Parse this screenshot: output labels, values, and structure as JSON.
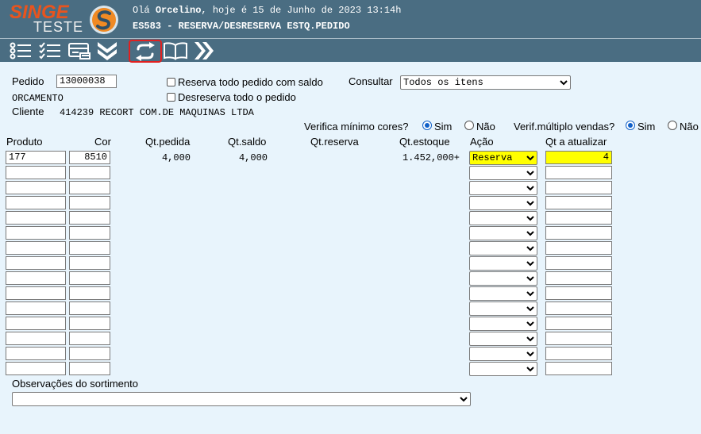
{
  "header": {
    "logo_top": "SINGE",
    "logo_bottom": "TESTE",
    "greeting_prefix": "Olá",
    "user_name": "Orcelino",
    "greeting_suffix": ", hoje é 15 de Junho de 2023 13:14h",
    "subtitle": "ES583 - RESERVA/DESRESERVA ESTQ.PEDIDO"
  },
  "toolbar": {
    "icons": [
      "list-icon",
      "checklist-icon",
      "card-icon",
      "double-chevron-down-icon",
      "swap-arrows-icon",
      "book-icon",
      "double-chevron-right-icon"
    ]
  },
  "form": {
    "pedido_label": "Pedido",
    "pedido_value": "13000038",
    "orcamento_label": "ORCAMENTO",
    "cliente_label": "Cliente",
    "cliente_value": "414239  RECORT COM.DE MAQUINAS LTDA",
    "reserva_todo_label": "Reserva todo pedido com saldo",
    "desreserva_todo_label": "Desreserva todo o pedido",
    "consultar_label": "Consultar",
    "consultar_value": "Todos os itens",
    "verifica_cores_label": "Verifica mínimo cores?",
    "verif_multiplo_label": "Verif.múltiplo vendas?",
    "sim_label": "Sim",
    "nao_label": "Não",
    "observacoes_label": "Observações do sortimento",
    "observacoes_value": ""
  },
  "table": {
    "headers": {
      "produto": "Produto",
      "cor": "Cor",
      "qt_pedida": "Qt.pedida",
      "qt_saldo": "Qt.saldo",
      "qt_reserva": "Qt.reserva",
      "qt_estoque": "Qt.estoque",
      "acao": "Ação",
      "qt_atualizar": "Qt a atualizar"
    },
    "row1": {
      "produto": "177",
      "cor": "8510",
      "qt_pedida": "4,000",
      "qt_saldo": "4,000",
      "qt_reserva": "",
      "qt_estoque": "1.452,000+",
      "acao": "Reserva",
      "qt_atualizar": "4"
    }
  },
  "colors": {
    "header_bg": "#4a6d82",
    "page_bg": "#e8f4fc",
    "highlight": "#ffff00",
    "logo_orange": "#e8541e",
    "active_outline": "#e02020"
  }
}
